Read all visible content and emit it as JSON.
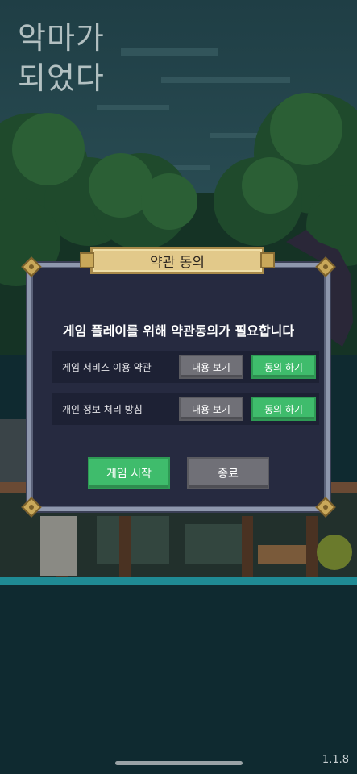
{
  "game_title": [
    "악마가",
    "되었다"
  ],
  "dialog": {
    "title": "약관 동의",
    "heading": "게임 플레이를 위해 약관동의가 필요합니다",
    "rows": [
      {
        "label": "게임 서비스 이용 약관",
        "view_label": "내용 보기",
        "agree_label": "동의 하기"
      },
      {
        "label": "개인 정보 처리 방침",
        "view_label": "내용 보기",
        "agree_label": "동의 하기"
      }
    ],
    "start_label": "게임 시작",
    "exit_label": "종료"
  },
  "version": "1.1.8",
  "colors": {
    "panel": "#262a40",
    "accent_green": "#3fbc6c",
    "button_gray": "#707077",
    "gold": "#e2c98a"
  }
}
